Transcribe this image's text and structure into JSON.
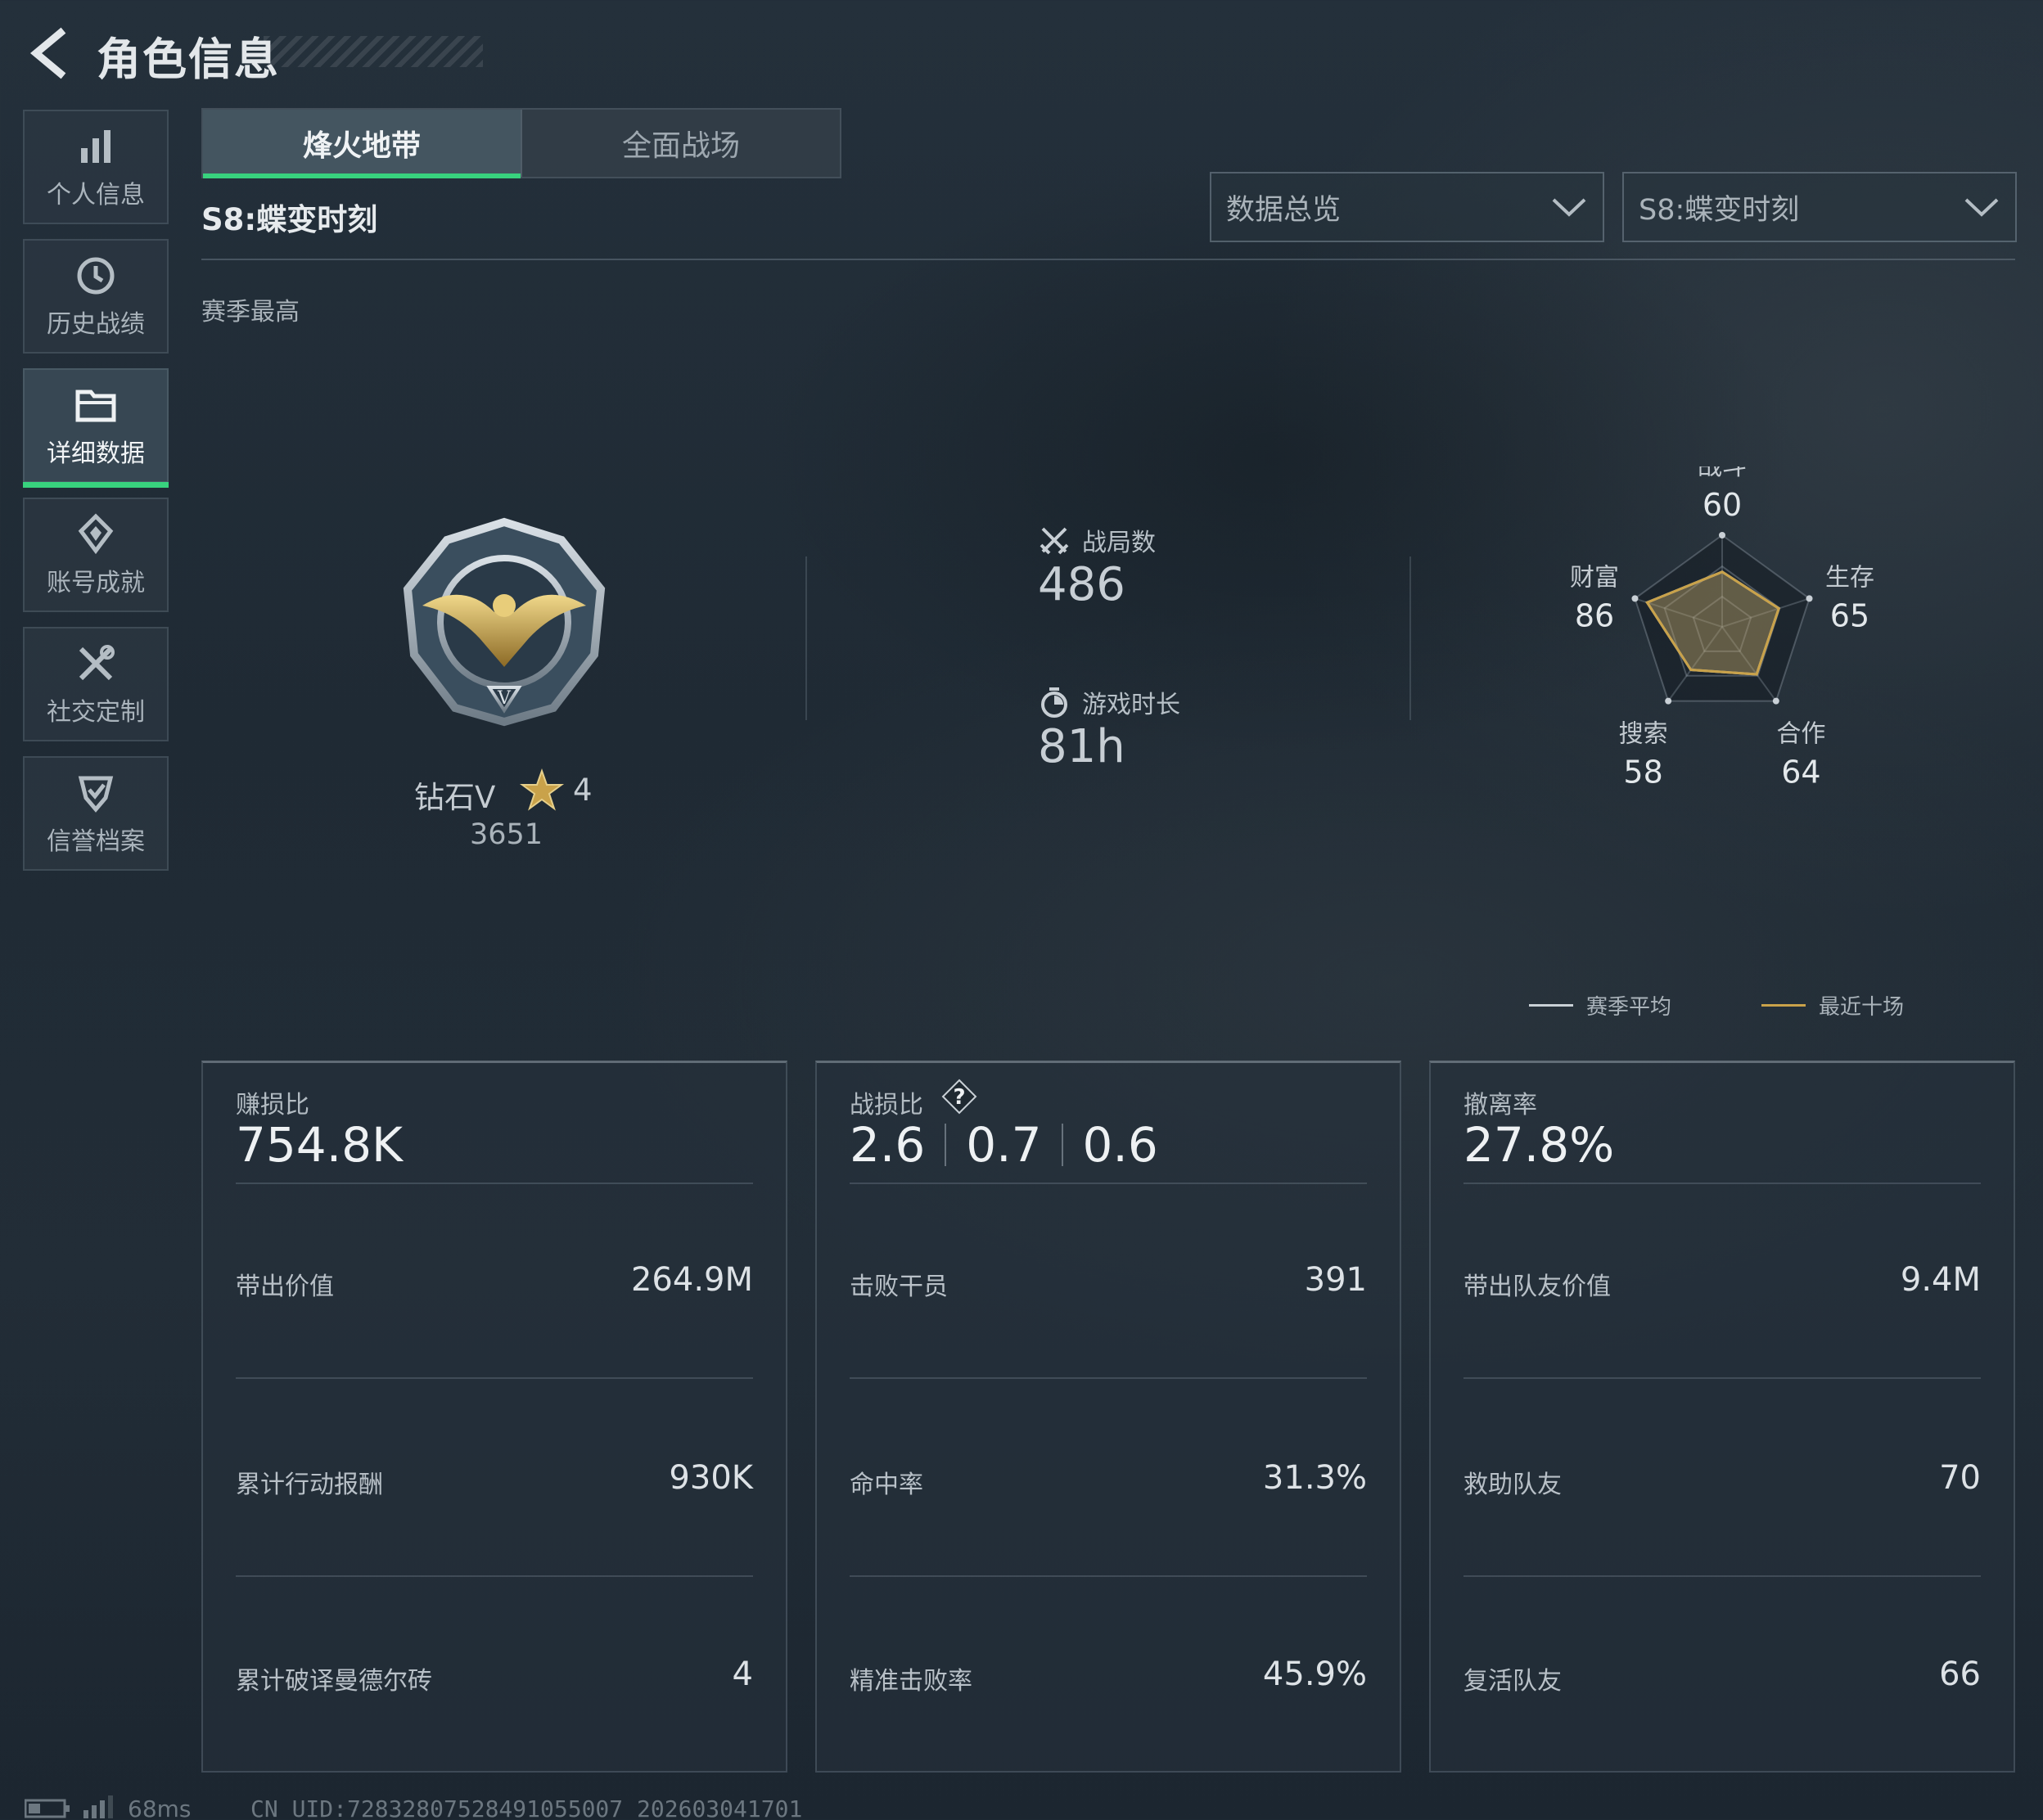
{
  "header": {
    "title": "角色信息"
  },
  "sidebar": {
    "items": [
      {
        "label": "个人信息",
        "icon": "bar-chart-icon"
      },
      {
        "label": "历史战绩",
        "icon": "history-clock-icon"
      },
      {
        "label": "详细数据",
        "icon": "folder-icon"
      },
      {
        "label": "账号成就",
        "icon": "medal-icon"
      },
      {
        "label": "社交定制",
        "icon": "tools-icon"
      },
      {
        "label": "信誉档案",
        "icon": "shield-check-icon"
      }
    ],
    "active_index": 2
  },
  "tabs": [
    {
      "label": "烽火地带",
      "active": true
    },
    {
      "label": "全面战场",
      "active": false
    }
  ],
  "season_title": "S8:蝶变时刻",
  "filters": {
    "data_mode": "数据总览",
    "season": "S8:蝶变时刻"
  },
  "season_best_label": "赛季最高",
  "rank": {
    "name": "钻石V",
    "stars": "4",
    "score": "3651"
  },
  "overview": {
    "matches_label": "战局数",
    "matches_value": "486",
    "playtime_label": "游戏时长",
    "playtime_value": "81h"
  },
  "radar": {
    "axes": [
      {
        "label": "战斗",
        "value": "60",
        "avg": 60,
        "recent": 60
      },
      {
        "label": "生存",
        "value": "65",
        "avg": 65,
        "recent": 65
      },
      {
        "label": "合作",
        "value": "64",
        "avg": 64,
        "recent": 64
      },
      {
        "label": "搜索",
        "value": "58",
        "avg": 58,
        "recent": 58
      },
      {
        "label": "财富",
        "value": "86",
        "avg": 86,
        "recent": 86
      }
    ],
    "max": 100
  },
  "legend": {
    "season_avg": "赛季平均",
    "recent_ten": "最近十场",
    "season_avg_color": "#c9d0d6",
    "recent_ten_color": "#c9a24a"
  },
  "cards": {
    "profit": {
      "label": "赚损比",
      "value": "754.8K",
      "rows": [
        {
          "label": "带出价值",
          "value": "264.9M"
        },
        {
          "label": "累计行动报酬",
          "value": "930K"
        },
        {
          "label": "累计破译曼德尔砖",
          "value": "4"
        }
      ]
    },
    "kd": {
      "label": "战损比",
      "values": [
        "2.6",
        "0.7",
        "0.6"
      ],
      "rows": [
        {
          "label": "击败干员",
          "value": "391"
        },
        {
          "label": "命中率",
          "value": "31.3%"
        },
        {
          "label": "精准击败率",
          "value": "45.9%"
        }
      ]
    },
    "extract": {
      "label": "撤离率",
      "value": "27.8%",
      "rows": [
        {
          "label": "带出队友价值",
          "value": "9.4M"
        },
        {
          "label": "救助队友",
          "value": "70"
        },
        {
          "label": "复活队友",
          "value": "66"
        }
      ]
    }
  },
  "footer": {
    "ping": "68ms",
    "uid": "CN UID:7283280752849105500​7_202603041701"
  },
  "colors": {
    "accent": "#38d27e",
    "gold": "#c9a24a"
  }
}
